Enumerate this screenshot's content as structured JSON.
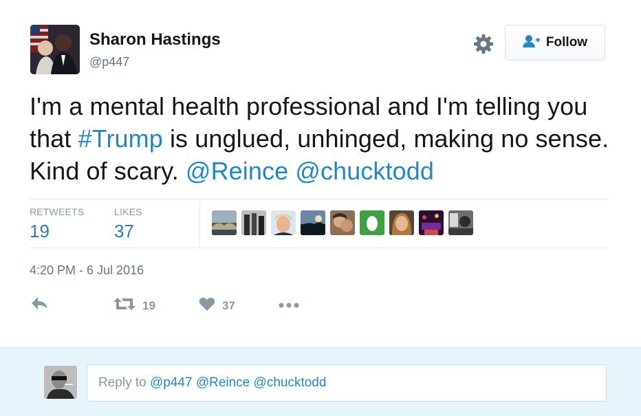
{
  "user": {
    "name": "Sharon Hastings",
    "handle": "@p447"
  },
  "follow_button": {
    "label": "Follow"
  },
  "tweet": {
    "segments": [
      {
        "text": "I'm a mental health professional and I'm telling you that ",
        "type": "text"
      },
      {
        "text": "#Trump",
        "type": "hashtag"
      },
      {
        "text": " is unglued, unhinged, making no sense. Kind of scary. ",
        "type": "text"
      },
      {
        "text": "@Reince",
        "type": "mention"
      },
      {
        "text": " ",
        "type": "text"
      },
      {
        "text": "@chucktodd",
        "type": "mention"
      }
    ]
  },
  "stats": {
    "retweets_label": "RETWEETS",
    "retweets_value": "19",
    "likes_label": "LIKES",
    "likes_value": "37"
  },
  "timestamp": "4:20 PM - 6 Jul 2016",
  "actions": {
    "retweet_count": "19",
    "like_count": "37"
  },
  "reply": {
    "prefix": "Reply to ",
    "mentions": "@p447 @Reince @chucktodd"
  },
  "colors": {
    "link": "#1f8ac2",
    "muted": "#8899a6",
    "reply_bg": "#e8f4fb"
  },
  "icons": [
    "gear-icon",
    "follow-person-icon",
    "reply-icon",
    "retweet-icon",
    "heart-icon",
    "more-icon"
  ]
}
